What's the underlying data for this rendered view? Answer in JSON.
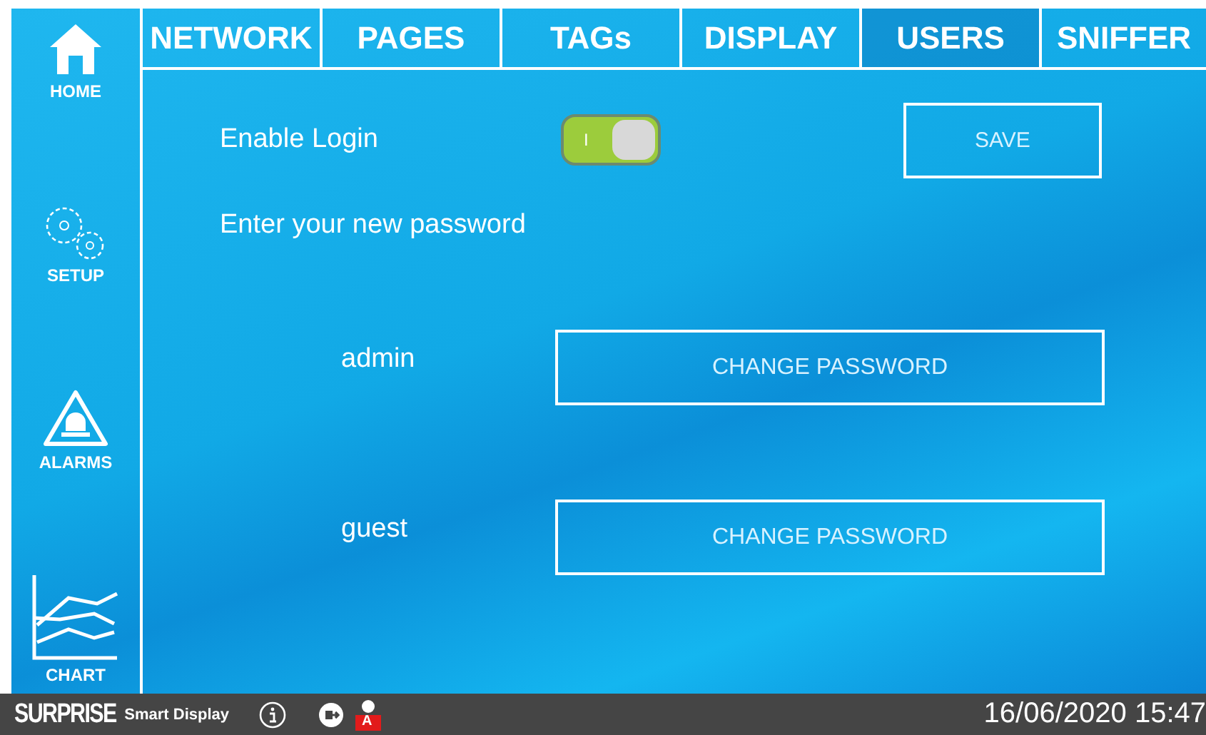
{
  "sidebar": {
    "items": [
      {
        "kind": "home",
        "label": "HOME"
      },
      {
        "kind": "setup",
        "label": "SETUP"
      },
      {
        "kind": "alarms",
        "label": "ALARMS"
      },
      {
        "kind": "chart",
        "label": "CHART"
      }
    ]
  },
  "tabs": [
    {
      "label": "NETWORK",
      "selected": false
    },
    {
      "label": "PAGES",
      "selected": false
    },
    {
      "label": "TAGs",
      "selected": false
    },
    {
      "label": "DISPLAY",
      "selected": false
    },
    {
      "label": "USERS",
      "selected": true
    },
    {
      "label": "SNIFFER",
      "selected": false
    }
  ],
  "enable_login": {
    "label": "Enable Login",
    "on": true,
    "toggle_text": "I"
  },
  "save_button": "SAVE",
  "password_prompt": "Enter your new password",
  "users": [
    {
      "name": "admin",
      "button": "CHANGE PASSWORD"
    },
    {
      "name": "guest",
      "button": "CHANGE PASSWORD"
    }
  ],
  "status_bar": {
    "brand": "SURPRISE",
    "product": "Smart Display",
    "user_badge": "A",
    "datetime": "16/06/2020 15:47"
  }
}
